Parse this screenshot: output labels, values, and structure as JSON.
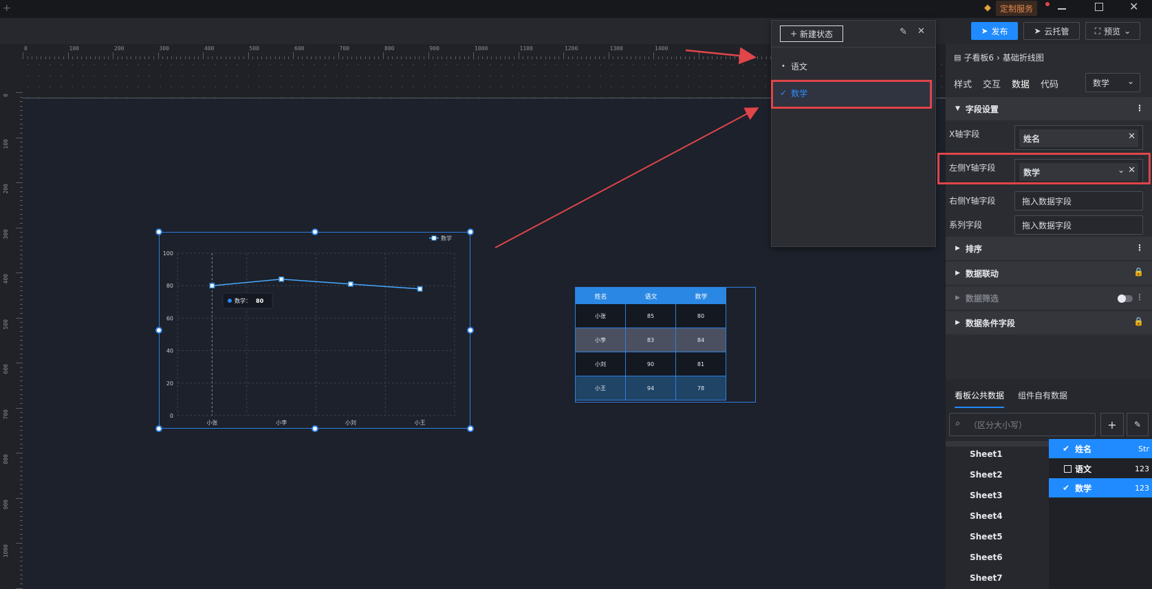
{
  "window": {
    "service_label": "定制服务"
  },
  "toolbar": {
    "publish_label": "发布",
    "cloud_label": "云托管",
    "preview_label": "预览"
  },
  "ruler": {
    "h_labels": [
      "0",
      "100",
      "200",
      "300",
      "400",
      "500",
      "600",
      "700",
      "800",
      "900",
      "1000",
      "1100",
      "1200",
      "1300",
      "1400"
    ],
    "v_labels": [
      "0",
      "100",
      "200",
      "300",
      "400",
      "500",
      "600",
      "700",
      "800",
      "900",
      "1000"
    ]
  },
  "popup": {
    "new_state_label": "新建状态",
    "states": [
      {
        "label": "语文",
        "selected": false
      },
      {
        "label": "数学",
        "selected": true
      }
    ]
  },
  "breadcrumb": {
    "parent": "子看板6",
    "current": "基础折线图"
  },
  "tabs": [
    {
      "label": "样式",
      "active": false
    },
    {
      "label": "交互",
      "active": false
    },
    {
      "label": "数据",
      "active": true
    },
    {
      "label": "代码",
      "active": false
    }
  ],
  "state_select": {
    "value": "数学"
  },
  "fields_section": {
    "title": "字段设置"
  },
  "fields": {
    "x_label": "X轴字段",
    "x_value": "姓名",
    "left_y_label": "左侧Y轴字段",
    "left_y_value": "数学",
    "right_y_label": "右侧Y轴字段",
    "right_y_placeholder": "拖入数据字段",
    "series_label": "系列字段",
    "series_placeholder": "拖入数据字段"
  },
  "sections": {
    "sort": "排序",
    "linkage": "数据联动",
    "filter": "数据筛选",
    "condition": "数据条件字段"
  },
  "data_tabs": {
    "public": "看板公共数据",
    "own": "组件自有数据"
  },
  "search": {
    "placeholder": "（区分大小写）"
  },
  "sheets": [
    "Sheet1",
    "Sheet2",
    "Sheet3",
    "Sheet4",
    "Sheet5",
    "Sheet6",
    "Sheet7"
  ],
  "columns": [
    {
      "name": "姓名",
      "type": "Str",
      "checked": true
    },
    {
      "name": "语文",
      "type": "123",
      "checked": false
    },
    {
      "name": "数学",
      "type": "123",
      "checked": true
    }
  ],
  "table": {
    "headers": [
      "姓名",
      "语文",
      "数学"
    ],
    "rows": [
      [
        "小张",
        "85",
        "80"
      ],
      [
        "小李",
        "83",
        "84"
      ],
      [
        "小刘",
        "90",
        "81"
      ],
      [
        "小王",
        "94",
        "78"
      ]
    ]
  },
  "chart_data": {
    "type": "line",
    "categories": [
      "小张",
      "小李",
      "小刘",
      "小王"
    ],
    "series": [
      {
        "name": "数学",
        "values": [
          80,
          84,
          81,
          78
        ]
      }
    ],
    "ylim": [
      0,
      100
    ],
    "yticks": [
      "0",
      "20",
      "40",
      "60",
      "80",
      "100"
    ],
    "tooltip": {
      "label": "数学：",
      "value": "80"
    },
    "grid": true,
    "legend": "top-right",
    "colors": {
      "line": "#4aa8ff",
      "accent": "#1f8bff",
      "highlight": "#e0454a"
    }
  }
}
